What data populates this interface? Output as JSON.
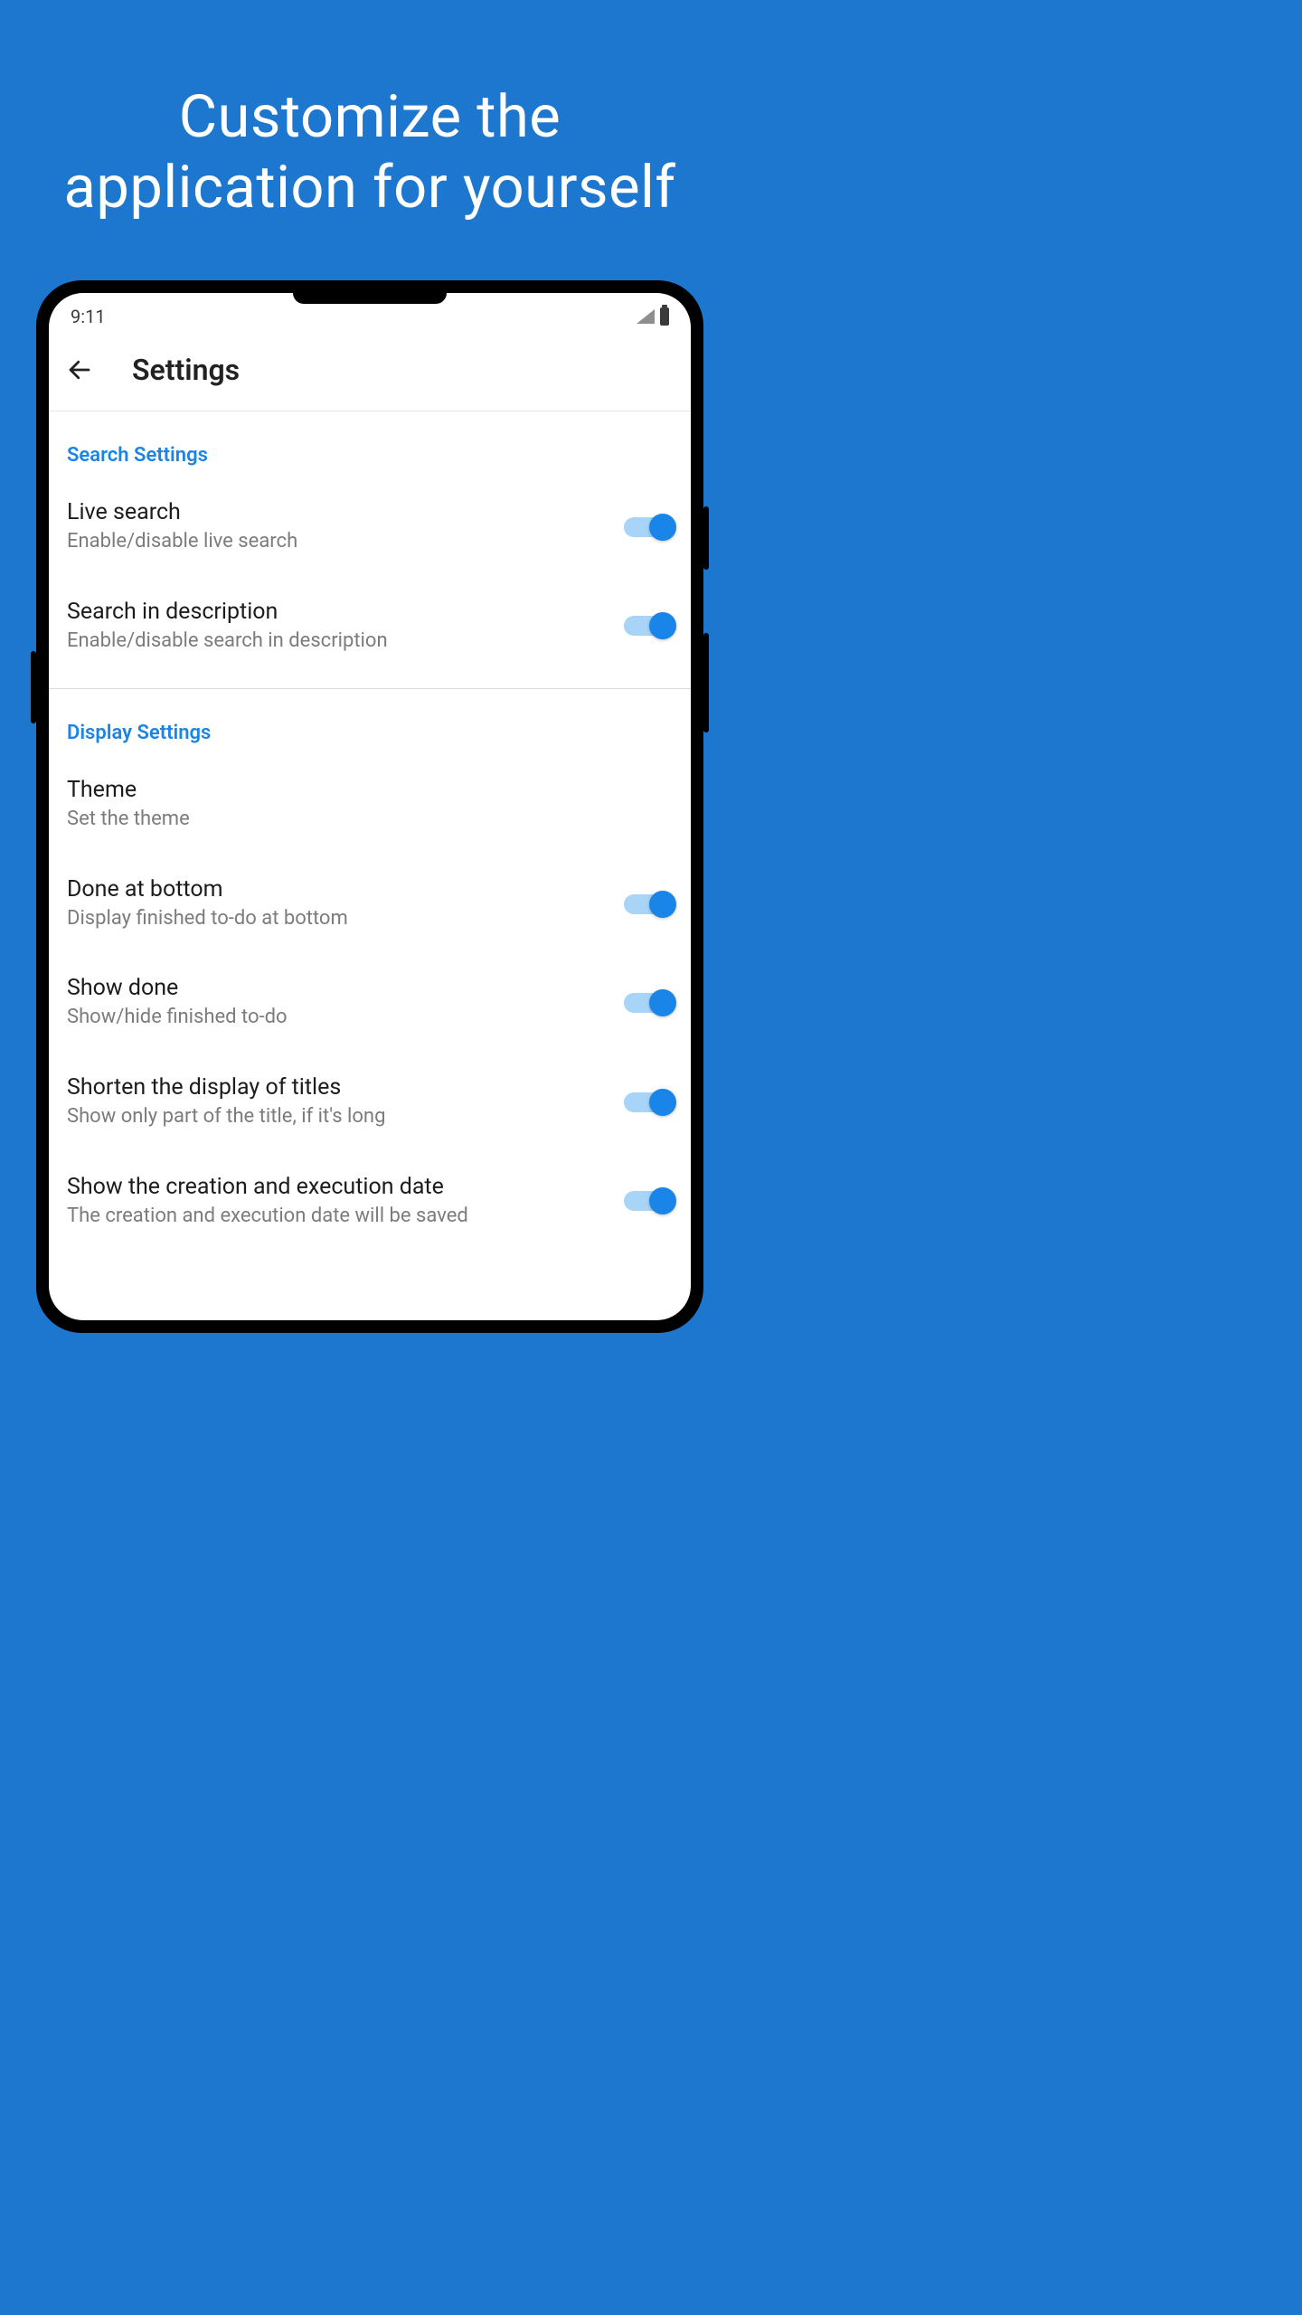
{
  "promo": {
    "headline": "Customize the application for yourself"
  },
  "status": {
    "time": "9:11"
  },
  "appbar": {
    "title": "Settings"
  },
  "sections": {
    "search": {
      "header": "Search Settings",
      "live_search": {
        "title": "Live search",
        "sub": "Enable/disable live search"
      },
      "search_desc": {
        "title": "Search in description",
        "sub": "Enable/disable search in description"
      }
    },
    "display": {
      "header": "Display Settings",
      "theme": {
        "title": "Theme",
        "sub": "Set the theme"
      },
      "done_bottom": {
        "title": "Done at bottom",
        "sub": "Display finished to-do at bottom"
      },
      "show_done": {
        "title": "Show done",
        "sub": "Show/hide finished to-do"
      },
      "shorten_titles": {
        "title": "Shorten the display of titles",
        "sub": "Show only part of the title, if it's long"
      },
      "creation_date": {
        "title": "Show the creation and execution date",
        "sub": "The creation and execution date will be saved"
      }
    }
  }
}
